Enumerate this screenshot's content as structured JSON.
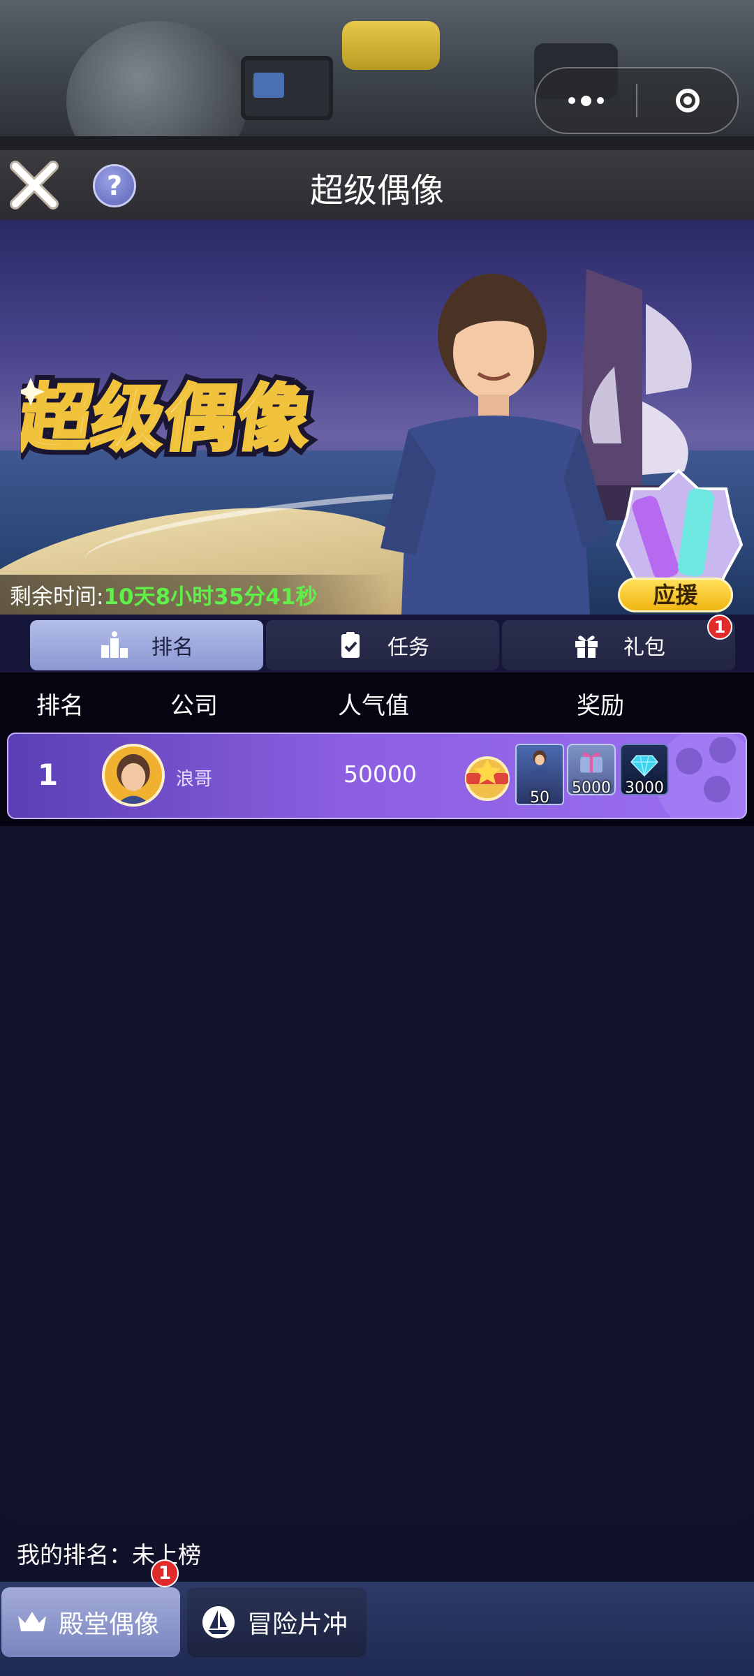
{
  "header": {
    "title": "超级偶像",
    "help_symbol": "?"
  },
  "banner": {
    "logo_text": "超级偶像",
    "timer_label": "剩余时间:",
    "timer_value": "10天8小时35分41秒",
    "support_label": "应援"
  },
  "tabs": [
    {
      "label": "排名",
      "icon": "podium-icon",
      "active": true
    },
    {
      "label": "任务",
      "icon": "clipboard-check-icon",
      "active": false
    },
    {
      "label": "礼包",
      "icon": "gift-icon",
      "active": false,
      "badge": "1"
    }
  ],
  "table": {
    "columns": [
      "排名",
      "公司",
      "人气值",
      "奖励"
    ],
    "rows": [
      {
        "rank": "1",
        "company": "浪哥",
        "popularity": "50000",
        "rewards": [
          {
            "icon": "medal-icon",
            "count": ""
          },
          {
            "icon": "idol-card-icon",
            "count": "50"
          },
          {
            "icon": "giftbox-icon",
            "count": "5000"
          },
          {
            "icon": "diamond-icon",
            "count": "3000"
          }
        ]
      }
    ]
  },
  "footer": {
    "my_rank": "我的排名：未上榜",
    "buttons": [
      {
        "label": "殿堂偶像",
        "icon": "crown-icon",
        "badge": "1",
        "active": true
      },
      {
        "label": "冒险片冲",
        "icon": "ship-icon",
        "active": false
      }
    ]
  },
  "colors": {
    "timer_green": "#5ff04a",
    "badge_red": "#e12a2a",
    "row_purple": "#8b5fe0"
  }
}
